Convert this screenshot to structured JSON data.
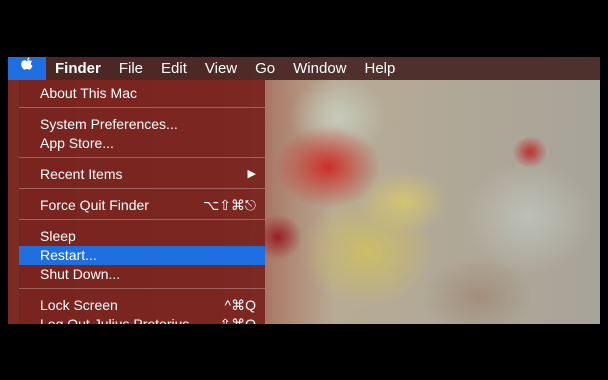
{
  "menubar": {
    "apple_icon": "apple-logo-icon",
    "items": [
      "Finder",
      "File",
      "Edit",
      "View",
      "Go",
      "Window",
      "Help"
    ]
  },
  "apple_menu": {
    "about": "About This Mac",
    "system_preferences": "System Preferences...",
    "app_store": "App Store...",
    "recent_items": "Recent Items",
    "recent_items_arrow": "▶",
    "force_quit": "Force Quit Finder",
    "force_quit_shortcut": "⌥⇧⌘⎋",
    "sleep": "Sleep",
    "restart": "Restart...",
    "shut_down": "Shut Down...",
    "lock_screen": "Lock Screen",
    "lock_screen_shortcut": "^⌘Q",
    "log_out": "Log Out Julius Pretorius...",
    "log_out_shortcut": "⇧⌘Q"
  },
  "colors": {
    "highlight": "#1f6fe0",
    "menu_bg": "#78241e",
    "background": "#000000"
  }
}
